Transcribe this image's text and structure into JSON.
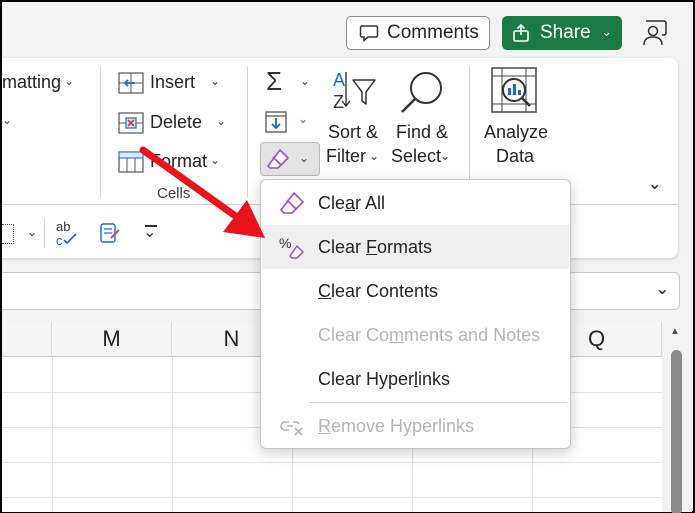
{
  "topbar": {
    "comments_label": "Comments",
    "share_label": "Share"
  },
  "ribbon": {
    "formatting_partial": "matting",
    "cells": {
      "insert_label": "Insert",
      "delete_label": "Delete",
      "format_label": "Format",
      "group_label": "Cells"
    },
    "editing": {
      "sort_filter_line1": "Sort &",
      "sort_filter_line2": "Filter",
      "find_select_line1": "Find &",
      "find_select_line2": "Select"
    },
    "analysis": {
      "analyze_line1": "Analyze",
      "analyze_line2": "Data"
    }
  },
  "grid": {
    "columns": [
      "M",
      "N",
      "Q"
    ]
  },
  "clear_menu": {
    "items": [
      {
        "pre": "Cle",
        "key": "a",
        "post": "r All",
        "state": "normal"
      },
      {
        "pre": "Clear ",
        "key": "F",
        "post": "ormats",
        "state": "hover"
      },
      {
        "pre": "",
        "key": "C",
        "post": "lear Contents",
        "state": "normal"
      },
      {
        "pre": "Clear Co",
        "key": "m",
        "post": "ments and Notes",
        "state": "disabled"
      },
      {
        "pre": "Clear Hyper",
        "key": "l",
        "post": "inks",
        "state": "normal"
      },
      {
        "pre": "",
        "key": "R",
        "post": "emove Hyperlinks",
        "state": "disabled"
      }
    ]
  },
  "colors": {
    "share_green": "#1b7a44",
    "eraser_purple": "#a64ac9",
    "annotation_arrow": "#e8141b"
  }
}
